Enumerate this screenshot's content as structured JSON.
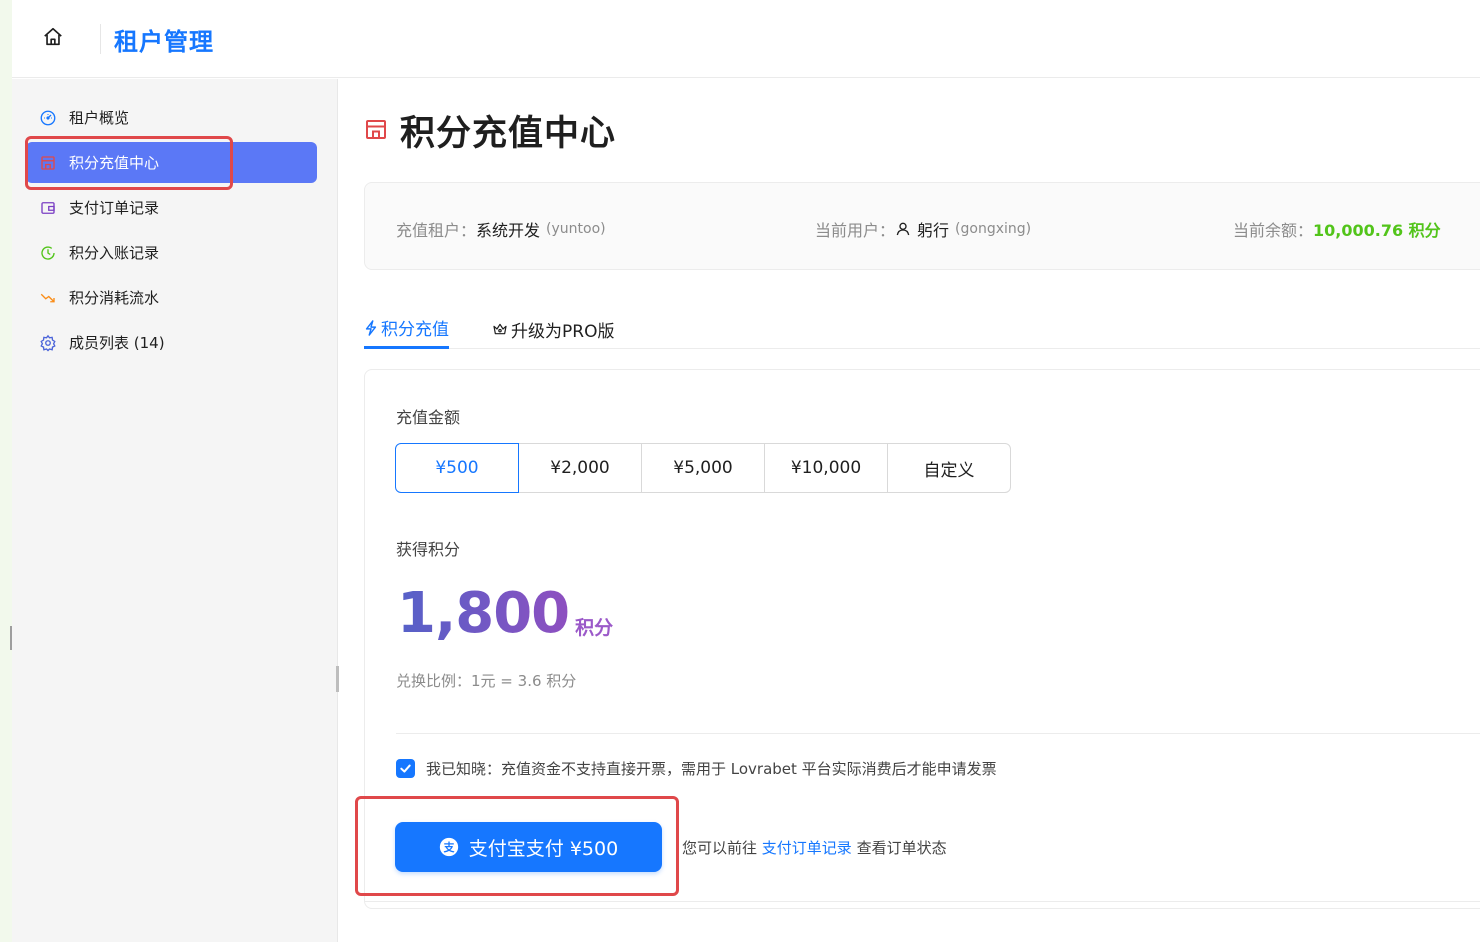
{
  "header": {
    "title": "租户管理"
  },
  "sidebar": {
    "items": [
      {
        "label": "租户概览",
        "icon": "dashboard-icon",
        "color": "#1677ff"
      },
      {
        "label": "积分充值中心",
        "icon": "shop-icon",
        "color": "#e0484a",
        "active": true
      },
      {
        "label": "支付订单记录",
        "icon": "wallet-icon",
        "color": "#7b3fc4"
      },
      {
        "label": "积分入账记录",
        "icon": "clock-icon",
        "color": "#52c41a"
      },
      {
        "label": "积分消耗流水",
        "icon": "trend-down-icon",
        "color": "#fa8c16"
      },
      {
        "label": "成员列表 (14)",
        "icon": "gear-icon",
        "color": "#4a63d9"
      }
    ]
  },
  "page": {
    "title": "积分充值中心"
  },
  "info": {
    "tenant_label": "充值租户：",
    "tenant_value": "系统开发",
    "tenant_code": "(yuntoo)",
    "user_label": "当前用户：",
    "user_value": "躬行",
    "user_code": "(gongxing)",
    "balance_label": "当前余额：",
    "balance_value": "10,000.76 积分"
  },
  "tabs": [
    {
      "label": "积分充值",
      "icon": "lightning-icon",
      "active": true
    },
    {
      "label": "升级为PRO版",
      "icon": "crown-icon",
      "active": false
    }
  ],
  "recharge": {
    "amount_label": "充值金额",
    "amounts": [
      "¥500",
      "¥2,000",
      "¥5,000",
      "¥10,000",
      "自定义"
    ],
    "selected_amount": "¥500",
    "points_label": "获得积分",
    "points_value": "1,800",
    "points_unit": "积分",
    "ratio_text": "兑换比例：1元 = 3.6 积分",
    "agree_checked": true,
    "agree_text": "我已知晓：充值资金不支持直接开票，需用于 Lovrabet 平台实际消费后才能申请发票",
    "pay_button": "支付宝支付 ¥500",
    "hint_prefix": "您可以前往",
    "hint_link": "支付订单记录",
    "hint_suffix": "查看订单状态"
  },
  "colors": {
    "primary": "#1677ff",
    "sidebar_active": "#5b78f6",
    "balance_green": "#52c41a",
    "highlight_red": "#e0484a"
  }
}
